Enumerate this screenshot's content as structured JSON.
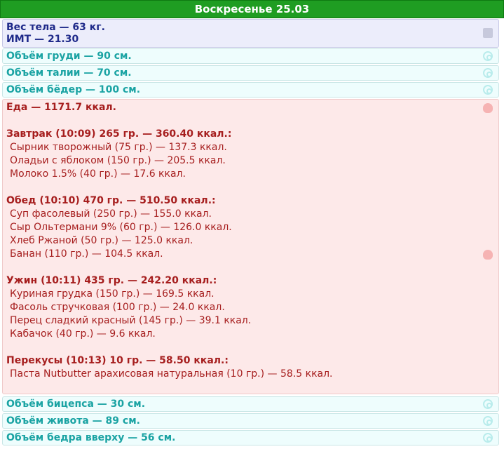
{
  "header": {
    "title": "Воскресенье 25.03"
  },
  "weight": {
    "line1": "Вес тела — 63 кг.",
    "line2": "ИМТ — 21.30",
    "icon": "scale-icon"
  },
  "measurements_top": [
    {
      "label": "Объём груди — 90 см.",
      "icon": "spiral-icon"
    },
    {
      "label": "Объём талии — 70 см.",
      "icon": "spiral-icon"
    },
    {
      "label": "Объём бёдер — 100 см.",
      "icon": "spiral-icon"
    }
  ],
  "food": {
    "total": "Еда — 1171.7 ккал.",
    "icon": "hand-icon",
    "meals": [
      {
        "title": "Завтрак (10:09) 265 гр. — 360.40 ккал.:",
        "items": [
          "Сырник творожный (75 гр.) — 137.3 ккал.",
          "Оладьи с яблоком (150 гр.) — 205.5 ккал.",
          "Молоко 1.5% (40 гр.) — 17.6 ккал."
        ]
      },
      {
        "title": "Обед (10:10) 470 гр. — 510.50 ккал.:",
        "items": [
          "Суп фасолевый (250 гр.) — 155.0 ккал.",
          "Сыр Ольтермани 9% (60 гр.) — 126.0 ккал.",
          "Хлеб Ржаной (50 гр.) — 125.0 ккал.",
          "Банан (110 гр.) — 104.5 ккал."
        ]
      },
      {
        "title": "Ужин (10:11) 435 гр. — 242.20 ккал.:",
        "items": [
          "Куриная грудка (150 гр.) — 169.5 ккал.",
          "Фасоль стручковая (100 гр.) — 24.0 ккал.",
          "Перец сладкий красный (145 гр.) — 39.1 ккал.",
          "Кабачок (40 гр.) — 9.6 ккал."
        ]
      },
      {
        "title": "Перекусы (10:13) 10 гр. — 58.50 ккал.:",
        "items": [
          "Паста Nutbutter арахисовая натуральная (10 гр.) — 58.5 ккал."
        ]
      }
    ]
  },
  "measurements_bottom": [
    {
      "label": "Объём бицепса — 30 см.",
      "icon": "spiral-icon"
    },
    {
      "label": "Объём живота — 89 см.",
      "icon": "spiral-icon"
    },
    {
      "label": "Объём бедра вверху — 56 см.",
      "icon": "spiral-icon"
    }
  ],
  "colors": {
    "header_bg": "#1f9d22",
    "weight_text": "#1f2a8a",
    "measure_text": "#1aa3a3",
    "food_text": "#a61e1e"
  }
}
